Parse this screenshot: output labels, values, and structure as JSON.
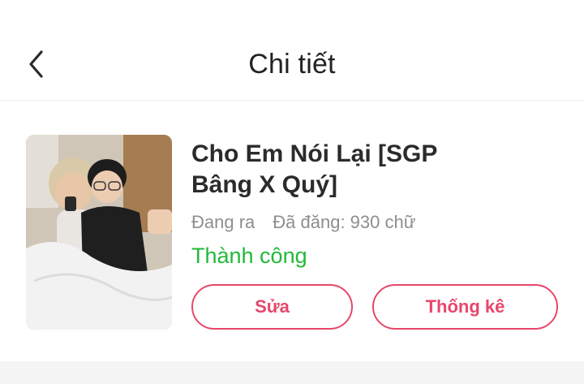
{
  "header": {
    "title": "Chi tiết",
    "back_icon": "chevron-left-icon"
  },
  "story": {
    "title": "Cho Em Nói Lại [SGP Bâng X Quý]",
    "status": "Đang ra",
    "word_count": "Đã đăng: 930 chữ",
    "result": "Thành công",
    "result_color": "#21b93a"
  },
  "actions": {
    "edit_label": "Sửa",
    "stats_label": "Thống kê",
    "accent_color": "#e8466a"
  }
}
